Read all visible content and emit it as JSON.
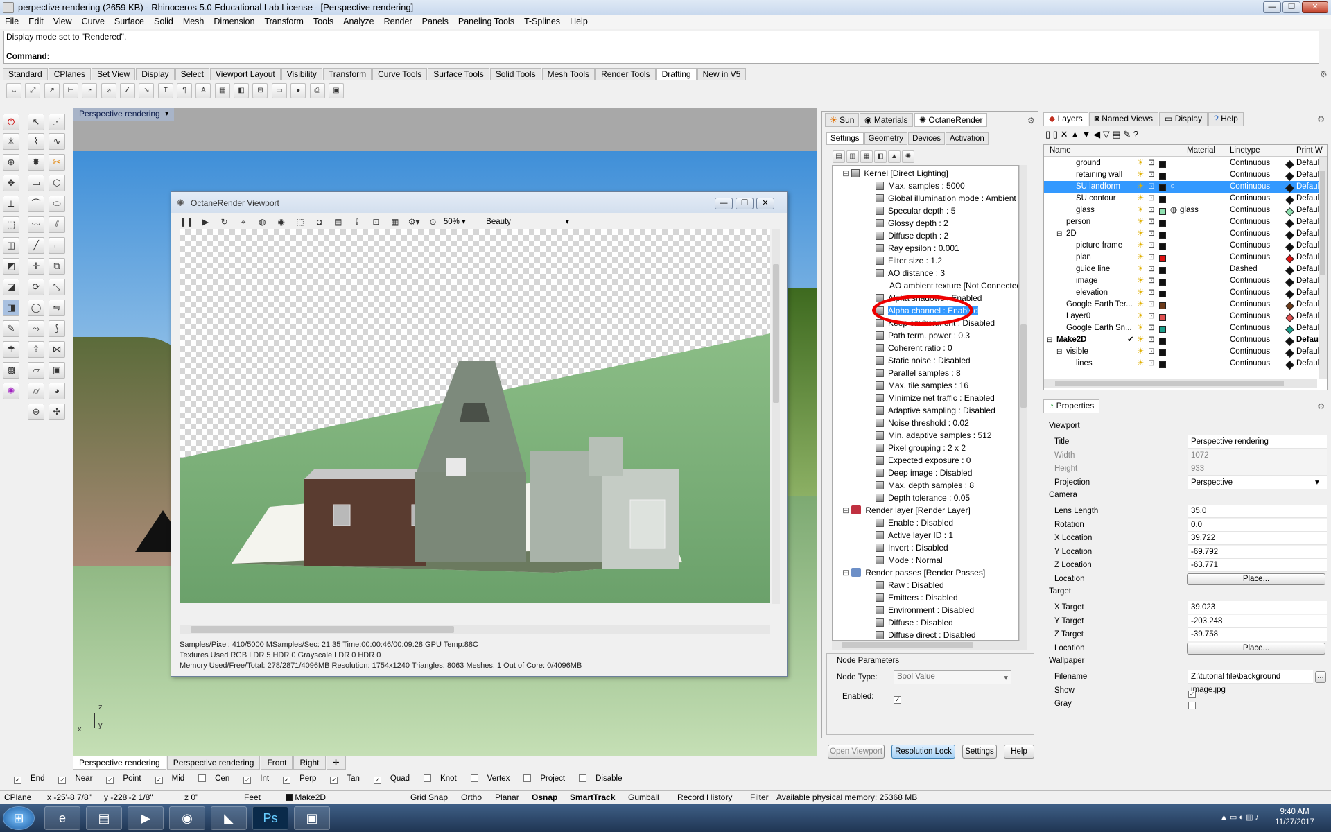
{
  "window": {
    "title": "perpective rendering (2659 KB) - Rhinoceros 5.0 Educational Lab License - [Perspective rendering]"
  },
  "menu": [
    "File",
    "Edit",
    "View",
    "Curve",
    "Surface",
    "Solid",
    "Mesh",
    "Dimension",
    "Transform",
    "Tools",
    "Analyze",
    "Render",
    "Panels",
    "Paneling Tools",
    "T-Splines",
    "Help"
  ],
  "command": {
    "history": "Display mode set to \"Rendered\".",
    "prompt": "Command:"
  },
  "toolbar_tabs": [
    "Standard",
    "CPlanes",
    "Set View",
    "Display",
    "Select",
    "Viewport Layout",
    "Visibility",
    "Transform",
    "Curve Tools",
    "Surface Tools",
    "Solid Tools",
    "Mesh Tools",
    "Render Tools",
    "Drafting",
    "New in V5"
  ],
  "toolbar_tabs_active": "Drafting",
  "viewport": {
    "title": "Perspective rendering",
    "tabs": [
      "Perspective rendering",
      "Perspective rendering",
      "Front",
      "Right"
    ],
    "axes": {
      "x": "x",
      "y": "y",
      "z": "z"
    }
  },
  "octane": {
    "title": "OctaneRender Viewport",
    "zoom": "50%",
    "pass": "Beauty",
    "status": [
      "Samples/Pixel: 410/5000  MSamples/Sec: 21.35  Time:00:00:46/00:09:28  GPU Temp:88C",
      "Textures Used RGB LDR 5  HDR 0  Grayscale LDR 0  HDR 0",
      "Memory Used/Free/Total: 278/2871/4096MB  Resolution: 1754x1240  Triangles: 8063  Meshes: 1 Out of Core: 0/4096MB"
    ]
  },
  "render_panel": {
    "tabs": [
      "Sun",
      "Materials",
      "OctaneRender"
    ],
    "subtabs": [
      "Settings",
      "Geometry",
      "Devices",
      "Activation"
    ],
    "tree": [
      {
        "label": "Kernel  [Direct Lighting]",
        "level": 0,
        "icon": "kernel"
      },
      {
        "label": "Max. samples : 5000",
        "level": 1
      },
      {
        "label": "Global illumination mode : Ambient occlusion",
        "level": 1
      },
      {
        "label": "Specular depth : 5",
        "level": 1
      },
      {
        "label": "Glossy depth : 2",
        "level": 1
      },
      {
        "label": "Diffuse depth : 2",
        "level": 1
      },
      {
        "label": "Ray epsilon : 0.001",
        "level": 1
      },
      {
        "label": "Filter size : 1.2",
        "level": 1
      },
      {
        "label": "AO distance : 3",
        "level": 1
      },
      {
        "label": "AO ambient texture  [Not Connected]",
        "level": 1,
        "noicon": true
      },
      {
        "label": "Alpha shadows : Enabled",
        "level": 1
      },
      {
        "label": "Alpha channel : Enabled",
        "level": 1,
        "selected": true
      },
      {
        "label": "Keep environment : Disabled",
        "level": 1
      },
      {
        "label": "Path term. power : 0.3",
        "level": 1
      },
      {
        "label": "Coherent ratio : 0",
        "level": 1
      },
      {
        "label": "Static noise : Disabled",
        "level": 1
      },
      {
        "label": "Parallel samples : 8",
        "level": 1
      },
      {
        "label": "Max. tile samples : 16",
        "level": 1
      },
      {
        "label": "Minimize net traffic : Enabled",
        "level": 1
      },
      {
        "label": "Adaptive sampling : Disabled",
        "level": 1
      },
      {
        "label": "Noise threshold : 0.02",
        "level": 1
      },
      {
        "label": "Min. adaptive samples : 512",
        "level": 1
      },
      {
        "label": "Pixel grouping : 2 x 2",
        "level": 1
      },
      {
        "label": "Expected exposure : 0",
        "level": 1
      },
      {
        "label": "Deep image : Disabled",
        "level": 1
      },
      {
        "label": "Max. depth samples : 8",
        "level": 1
      },
      {
        "label": "Depth tolerance : 0.05",
        "level": 1
      },
      {
        "label": "Render layer  [Render Layer]",
        "level": 0,
        "icon": "layer"
      },
      {
        "label": "Enable : Disabled",
        "level": 1
      },
      {
        "label": "Active layer ID : 1",
        "level": 1
      },
      {
        "label": "Invert : Disabled",
        "level": 1
      },
      {
        "label": "Mode : Normal",
        "level": 1
      },
      {
        "label": "Render passes  [Render Passes]",
        "level": 0,
        "icon": "passes"
      },
      {
        "label": "Raw : Disabled",
        "level": 1
      },
      {
        "label": "Emitters : Disabled",
        "level": 1
      },
      {
        "label": "Environment : Disabled",
        "level": 1
      },
      {
        "label": "Diffuse : Disabled",
        "level": 1
      },
      {
        "label": "Diffuse direct : Disabled",
        "level": 1
      }
    ],
    "node_params": {
      "title": "Node Parameters",
      "type_label": "Node Type:",
      "type_value": "Bool Value",
      "enabled_label": "Enabled:",
      "enabled_checked": true
    },
    "buttons": [
      "Open Viewport",
      "Resolution Lock",
      "Settings",
      "Help"
    ]
  },
  "layers_panel": {
    "tabs": [
      "Layers",
      "Named Views",
      "Display",
      "Help"
    ],
    "columns": [
      "Name",
      "Material",
      "Linetype",
      "Print W"
    ],
    "rows": [
      {
        "name": "ground",
        "indent": 2,
        "color": "#111111",
        "linetype": "Continuous",
        "print": "Default",
        "pcolor": "#111111"
      },
      {
        "name": "retaining wall",
        "indent": 2,
        "color": "#111111",
        "linetype": "Continuous",
        "print": "Default",
        "pcolor": "#111111"
      },
      {
        "name": "SU landform",
        "indent": 2,
        "color": "#111111",
        "linetype": "Continuous",
        "print": "Default",
        "pcolor": "#111111",
        "selected": true
      },
      {
        "name": "SU contour",
        "indent": 2,
        "color": "#111111",
        "linetype": "Continuous",
        "print": "Default",
        "pcolor": "#111111"
      },
      {
        "name": "glass",
        "indent": 2,
        "color": "#8fe0b0",
        "linetype": "Continuous",
        "print": "Default",
        "pcolor": "#8fe0b0",
        "material": "glass"
      },
      {
        "name": "person",
        "indent": 1,
        "color": "#111111",
        "linetype": "Continuous",
        "print": "Default",
        "pcolor": "#111111"
      },
      {
        "name": "2D",
        "indent": 1,
        "color": "#111111",
        "linetype": "Continuous",
        "print": "Default",
        "pcolor": "#111111",
        "expand": "−"
      },
      {
        "name": "picture frame",
        "indent": 2,
        "color": "#111111",
        "linetype": "Continuous",
        "print": "Default",
        "pcolor": "#111111"
      },
      {
        "name": "plan",
        "indent": 2,
        "color": "#dd1111",
        "linetype": "Continuous",
        "print": "Default",
        "pcolor": "#dd1111"
      },
      {
        "name": "guide line",
        "indent": 2,
        "color": "#111111",
        "linetype": "Dashed",
        "print": "Default",
        "pcolor": "#111111"
      },
      {
        "name": "image",
        "indent": 2,
        "color": "#111111",
        "linetype": "Continuous",
        "print": "Default",
        "pcolor": "#111111"
      },
      {
        "name": "elevation",
        "indent": 2,
        "color": "#111111",
        "linetype": "Continuous",
        "print": "Default",
        "pcolor": "#111111"
      },
      {
        "name": "Google Earth Ter...",
        "indent": 1,
        "color": "#6b3a1a",
        "linetype": "Continuous",
        "print": "Default",
        "pcolor": "#6b3a1a"
      },
      {
        "name": "Layer0",
        "indent": 1,
        "color": "#e05050",
        "linetype": "Continuous",
        "print": "Default",
        "pcolor": "#e05050"
      },
      {
        "name": "Google Earth Sn...",
        "indent": 1,
        "color": "#1a9e8a",
        "linetype": "Continuous",
        "print": "Default",
        "pcolor": "#1a9e8a"
      },
      {
        "name": "Make2D",
        "indent": 0,
        "color": "#111111",
        "linetype": "Continuous",
        "print": "Default",
        "pcolor": "#111111",
        "bold": true,
        "current": "✔",
        "expand": "−"
      },
      {
        "name": "visible",
        "indent": 1,
        "color": "#111111",
        "linetype": "Continuous",
        "print": "Default",
        "pcolor": "#111111",
        "expand": "−"
      },
      {
        "name": "lines",
        "indent": 2,
        "color": "#111111",
        "linetype": "Continuous",
        "print": "Default",
        "pcolor": "#111111"
      }
    ]
  },
  "properties": {
    "title": "Properties",
    "sections": [
      {
        "name": "Viewport",
        "rows": [
          {
            "k": "Title",
            "v": "Perspective rendering"
          },
          {
            "k": "Width",
            "v": "1072",
            "grey": true
          },
          {
            "k": "Height",
            "v": "933",
            "grey": true
          },
          {
            "k": "Projection",
            "v": "Perspective",
            "dropdown": true
          }
        ]
      },
      {
        "name": "Camera",
        "rows": [
          {
            "k": "Lens Length",
            "v": "35.0"
          },
          {
            "k": "Rotation",
            "v": "0.0"
          },
          {
            "k": "X Location",
            "v": "39.722"
          },
          {
            "k": "Y Location",
            "v": "-69.792"
          },
          {
            "k": "Z Location",
            "v": "-63.771"
          },
          {
            "k": "Location",
            "button": "Place..."
          }
        ]
      },
      {
        "name": "Target",
        "rows": [
          {
            "k": "X Target",
            "v": "39.023"
          },
          {
            "k": "Y Target",
            "v": "-203.248"
          },
          {
            "k": "Z Target",
            "v": "-39.758"
          },
          {
            "k": "Location",
            "button": "Place..."
          }
        ]
      },
      {
        "name": "Wallpaper",
        "rows": [
          {
            "k": "Filename",
            "v": "Z:\\tutorial file\\background image.jpg",
            "browse": "..."
          },
          {
            "k": "Show",
            "check": true
          },
          {
            "k": "Gray",
            "check": false
          }
        ]
      }
    ]
  },
  "osnap": [
    {
      "label": "End",
      "checked": true
    },
    {
      "label": "Near",
      "checked": true
    },
    {
      "label": "Point",
      "checked": true
    },
    {
      "label": "Mid",
      "checked": true
    },
    {
      "label": "Cen",
      "checked": false
    },
    {
      "label": "Int",
      "checked": true
    },
    {
      "label": "Perp",
      "checked": true
    },
    {
      "label": "Tan",
      "checked": true
    },
    {
      "label": "Quad",
      "checked": true
    },
    {
      "label": "Knot",
      "checked": false
    },
    {
      "label": "Vertex",
      "checked": false
    },
    {
      "label": "Project",
      "checked": false
    },
    {
      "label": "Disable",
      "checked": false
    }
  ],
  "status": {
    "cplane": "CPlane",
    "x": "x -25'-8 7/8\"",
    "y": "y -228'-2 1/8\"",
    "z": "z 0\"",
    "units": "Feet",
    "layer": "Make2D",
    "toggles": [
      "Grid Snap",
      "Ortho",
      "Planar",
      "Osnap",
      "SmartTrack",
      "Gumball",
      "Record History",
      "Filter"
    ],
    "memory": "Available physical memory: 25368 MB"
  },
  "taskbar": {
    "time": "9:40 AM",
    "date": "11/27/2017"
  }
}
